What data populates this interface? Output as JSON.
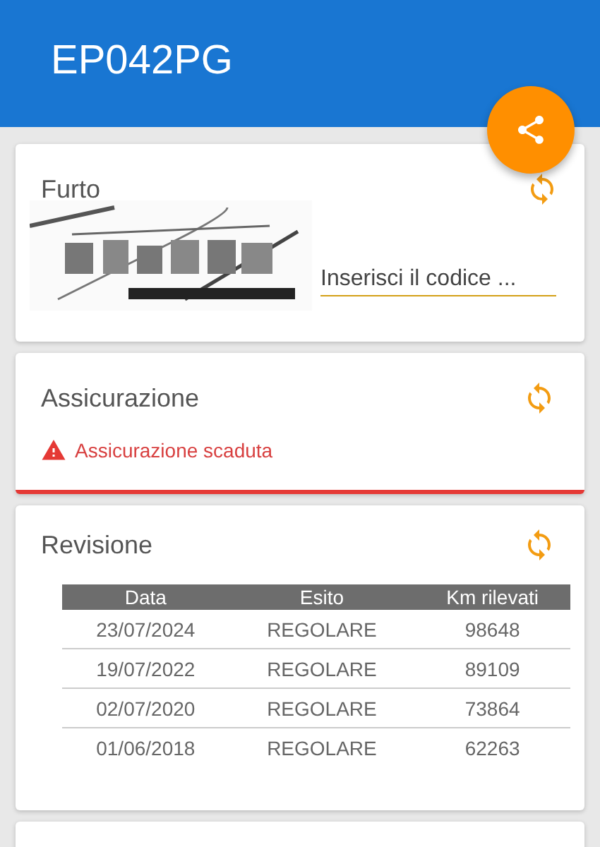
{
  "header": {
    "title": "EP042PG"
  },
  "theft": {
    "title": "Furto",
    "code_field": {
      "placeholder": "Inserisci il codice ..."
    }
  },
  "insurance": {
    "title": "Assicurazione",
    "alert": "Assicurazione scaduta",
    "expired": true
  },
  "inspection": {
    "title": "Revisione",
    "columns": [
      "Data",
      "Esito",
      "Km rilevati"
    ],
    "rows": [
      [
        "23/07/2024",
        "REGOLARE",
        "98648"
      ],
      [
        "19/07/2022",
        "REGOLARE",
        "89109"
      ],
      [
        "02/07/2020",
        "REGOLARE",
        "73864"
      ],
      [
        "01/06/2018",
        "REGOLARE",
        "62263"
      ]
    ]
  }
}
